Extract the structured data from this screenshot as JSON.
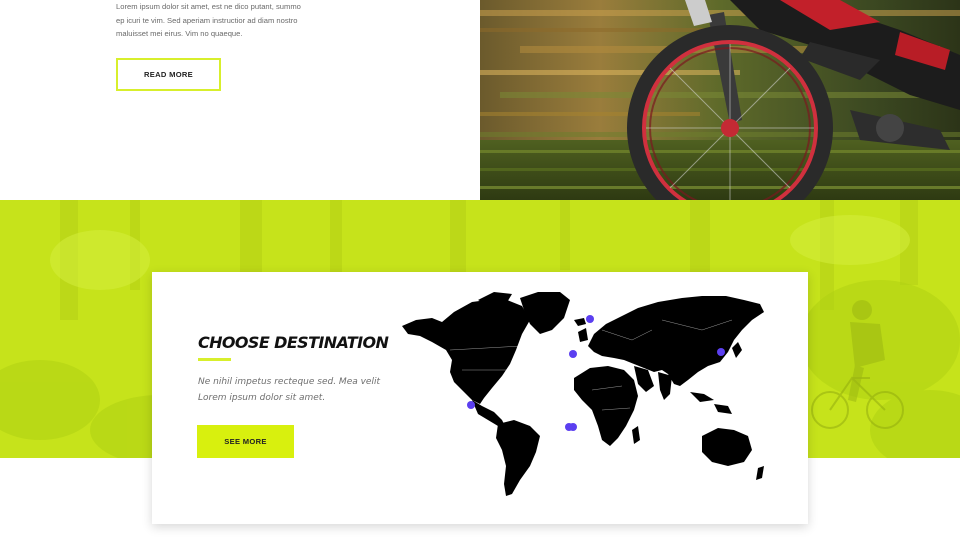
{
  "intro": {
    "lines": [
      "Lorem ipsum dolor sit amet, est ne dico putant, summo",
      "ep icuri te vim. Sed aperiam instructior ad diam nostro",
      "maluisset mei eirus. Vim no quaeque."
    ],
    "button_label": "READ MORE"
  },
  "destination": {
    "title": "CHOOSE DESTINATION",
    "text_lines": [
      "Ne nihil impetus recteque sed. Mea velit",
      "Lorem ipsum dolor sit amet."
    ],
    "button_label": "SEE MORE",
    "marker_count": 6
  },
  "colors": {
    "accent": "#d8ef2c",
    "green_band": "#c7e41b",
    "map_marker": "#5b3ff0",
    "map_land": "#000000"
  }
}
